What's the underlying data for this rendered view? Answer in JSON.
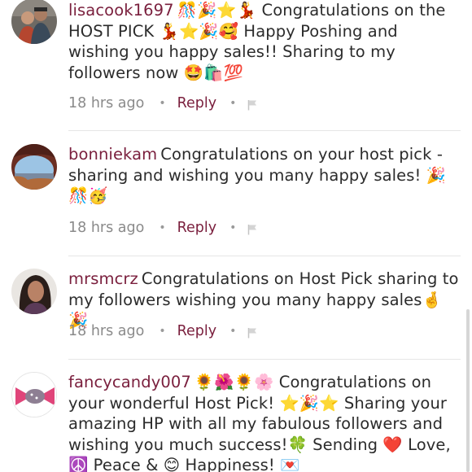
{
  "comments": [
    {
      "username": "lisacook1697",
      "body": "🎊🎉⭐💃 Congratulations on the HOST PICK 💃⭐🎉🥰 Happy Poshing and wishing you happy sales!! Sharing to my followers now 🤩🛍️💯",
      "time": "18 hrs ago",
      "reply": "Reply",
      "avatar_icon": "avatar-photo-couple-icon"
    },
    {
      "username": "bonniekam",
      "body": "Congratulations on your host pick - sharing and wishing you many happy sales! 🎉🎊🥳",
      "time": "18 hrs ago",
      "reply": "Reply",
      "avatar_icon": "avatar-photo-landscape-icon"
    },
    {
      "username": "mrsmcrz",
      "body": "Congratulations on Host Pick sharing to my followers wishing you many happy sales🤞🎉",
      "time": "18 hrs ago",
      "reply": "Reply",
      "avatar_icon": "avatar-photo-woman-icon"
    },
    {
      "username": "fancycandy007",
      "body": "🌻🌺🌻🌸 Congratulations on your wonderful Host Pick! ⭐🎉⭐ Sharing your amazing HP with all my fabulous followers and wishing you much success!🍀 Sending ❤️ Love, ☮️ Peace & 😊 Happiness! 💌",
      "time": "",
      "reply": "",
      "avatar_icon": "candy-avatar-icon"
    }
  ],
  "colors": {
    "username": "#7a1f3d",
    "reply": "#7a1f3d",
    "meta": "#8a8a8a",
    "text": "#2b2b2b"
  }
}
